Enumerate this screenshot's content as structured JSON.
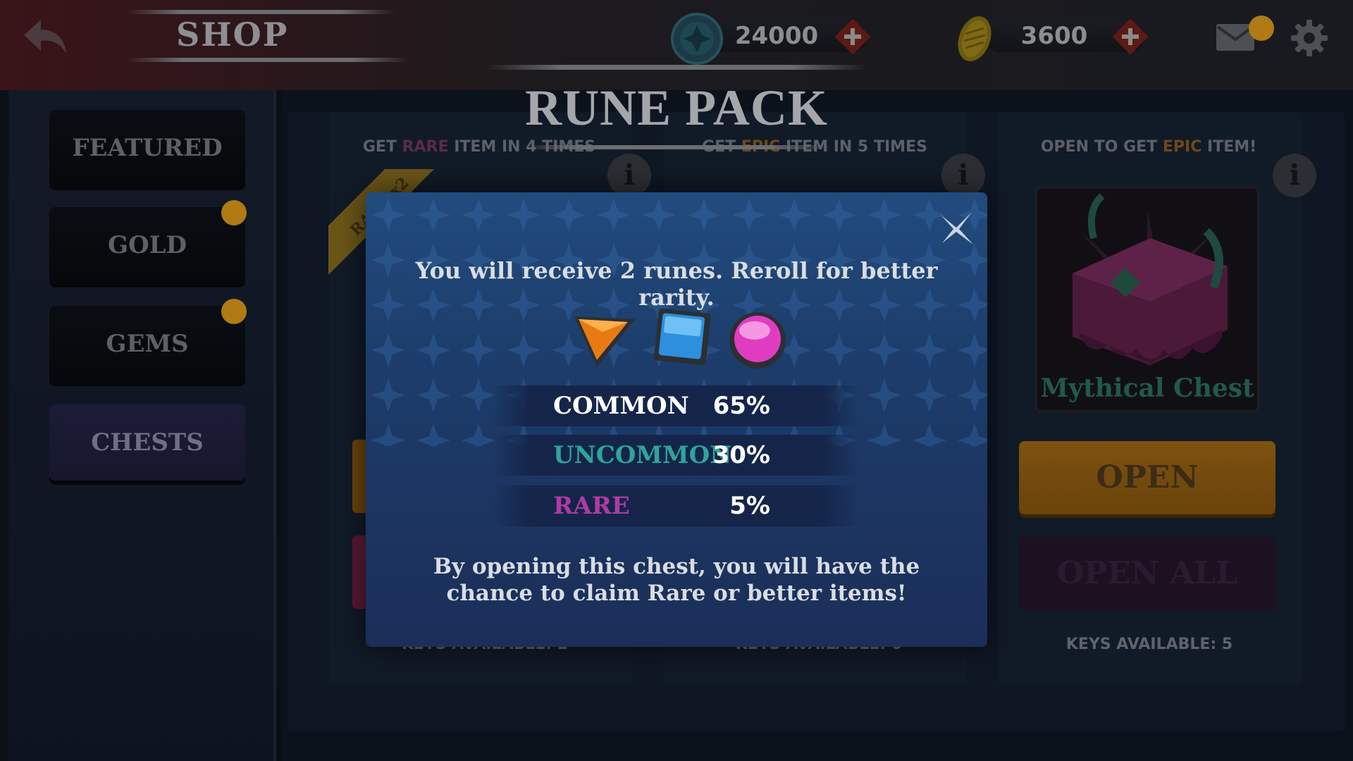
{
  "header": {
    "title": "SHOP",
    "gems_amount": "24000",
    "gold_amount": "3600"
  },
  "sidebar": {
    "items": [
      {
        "label": "FEATURED",
        "active": false,
        "badge": false
      },
      {
        "label": "GOLD",
        "active": false,
        "badge": true
      },
      {
        "label": "GEMS",
        "active": false,
        "badge": true
      },
      {
        "label": "CHESTS",
        "active": true,
        "badge": false
      }
    ]
  },
  "main": {
    "title": "RUNE PACK",
    "cards": [
      {
        "head_pre": "GET ",
        "head_hl": "RARE",
        "head_post": " ITEM IN 4 TIMES",
        "keys": "KEYS AVAILABLE: 2",
        "ribbon": "RARE x2"
      },
      {
        "head_pre": "GET ",
        "head_hl": "EPIC",
        "head_post": " ITEM IN 5 TIMES",
        "keys": "KEYS AVAILABLE: 0"
      },
      {
        "head_pre": "OPEN TO GET ",
        "head_hl": "EPIC",
        "head_post": " ITEM!",
        "keys": "KEYS AVAILABLE: 5",
        "chest_name": "Mythical Chest",
        "open_label": "OPEN",
        "open_all_label": "OPEN ALL"
      }
    ],
    "info_glyph": "i"
  },
  "modal": {
    "message": "You will receive 2 runes. Reroll for better rarity.",
    "runes": [
      "orange-triangle-rune",
      "blue-square-rune",
      "pink-circle-rune"
    ],
    "rarities": [
      {
        "name": "COMMON",
        "percent": "65%",
        "color": "#ffffff"
      },
      {
        "name": "UNCOMMON",
        "percent": "30%",
        "color": "#2fa39a"
      },
      {
        "name": "RARE",
        "percent": "5%",
        "color": "#b03aa0"
      }
    ],
    "footer": "By opening this chest, you will have the chance to claim Rare or better items!"
  },
  "colors": {
    "accent_gold": "#b07b14",
    "modal_bg": "#1f4274",
    "common": "#ffffff",
    "uncommon": "#2fa39a",
    "rare": "#b03aa0"
  }
}
